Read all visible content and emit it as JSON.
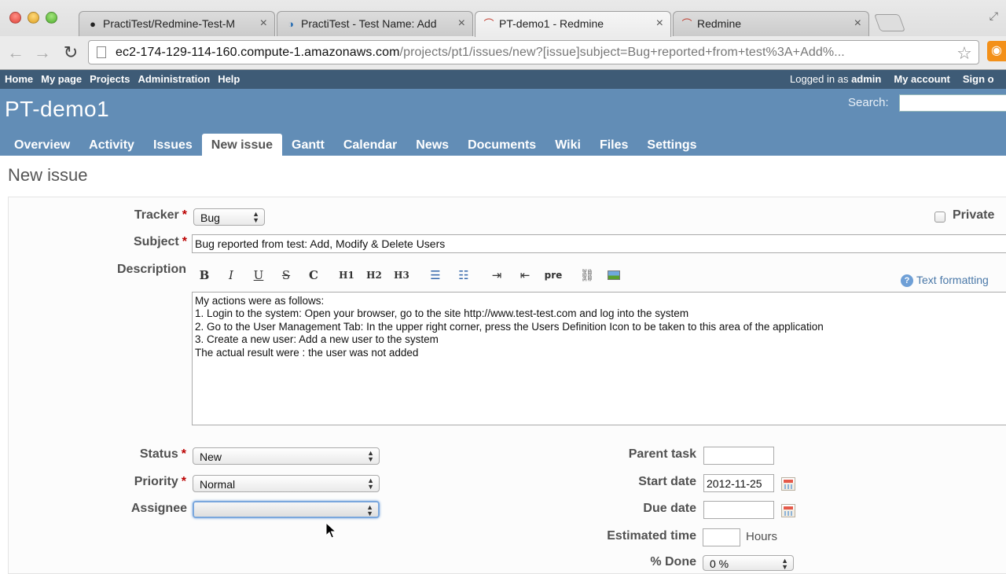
{
  "browser": {
    "tabs": [
      {
        "title": "PractiTest/Redmine-Test-M",
        "icon": "github-icon",
        "active": false
      },
      {
        "title": "PractiTest - Test Name: Add",
        "icon": "practitest-icon",
        "active": false
      },
      {
        "title": "PT-demo1 - Redmine",
        "icon": "redmine-icon",
        "active": true
      },
      {
        "title": "Redmine",
        "icon": "redmine-icon",
        "active": false
      }
    ],
    "url_host": "ec2-174-129-114-160.compute-1.amazonaws.com",
    "url_path": "/projects/pt1/issues/new?[issue]subject=Bug+reported+from+test%3A+Add%..."
  },
  "topmenu": {
    "items": [
      "Home",
      "My page",
      "Projects",
      "Administration",
      "Help"
    ],
    "logged_in_prefix": "Logged in as",
    "user": "admin",
    "my_account": "My account",
    "sign_out": "Sign o"
  },
  "header": {
    "project": "PT-demo1",
    "search_label": "Search:"
  },
  "mainmenu": [
    "Overview",
    "Activity",
    "Issues",
    "New issue",
    "Gantt",
    "Calendar",
    "News",
    "Documents",
    "Wiki",
    "Files",
    "Settings"
  ],
  "selected_menu": "New issue",
  "page_title": "New issue",
  "form": {
    "tracker_label": "Tracker",
    "tracker_value": "Bug",
    "private_label": "Private",
    "subject_label": "Subject",
    "subject_value": "Bug reported from test: Add, Modify & Delete Users",
    "description_label": "Description",
    "toolbar": [
      "B",
      "I",
      "U",
      "S",
      "C",
      "H1",
      "H2",
      "H3",
      "ul",
      "ol",
      "indent",
      "outdent",
      "pre",
      "link",
      "image"
    ],
    "toolbar_pre": "pre",
    "text_formatting": "Text formatting",
    "description_value": "My actions were as follows:\n1. Login to the system: Open your browser, go to the site http://www.test-test.com and log into the system\n2. Go to the User Management Tab: In the upper right corner, press the Users Definition Icon to be taken to this area of the application\n3. Create a new user: Add a new user to the system\nThe actual result were : the user was not added",
    "status_label": "Status",
    "status_value": "New",
    "priority_label": "Priority",
    "priority_value": "Normal",
    "assignee_label": "Assignee",
    "assignee_value": "",
    "parent_task_label": "Parent task",
    "start_date_label": "Start date",
    "start_date_value": "2012-11-25",
    "due_date_label": "Due date",
    "estimated_time_label": "Estimated time",
    "hours_label": "Hours",
    "done_label": "% Done",
    "done_value": "0 %",
    "required_mark": "*"
  }
}
